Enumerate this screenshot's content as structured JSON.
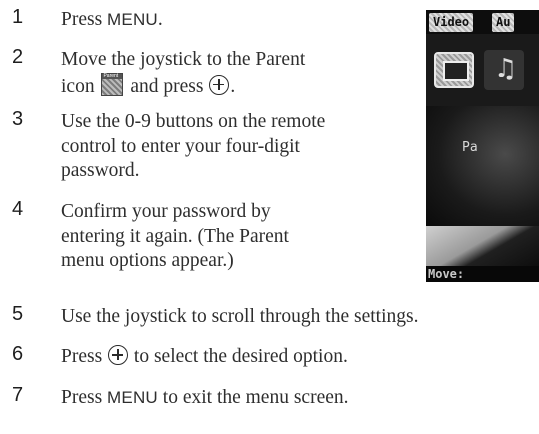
{
  "steps": [
    {
      "num": "1",
      "lines": [
        [
          "Press ",
          "MENU",
          "."
        ]
      ]
    },
    {
      "num": "2",
      "lines": [
        "Move the joystick to the Parent",
        [
          "icon ",
          "parent-icon",
          " and press ",
          "enter-icon",
          "."
        ]
      ]
    },
    {
      "num": "3",
      "lines": [
        "Use the 0-9 buttons on the remote",
        "control to enter your four-digit",
        "password."
      ]
    },
    {
      "num": "4",
      "lines": [
        "Confirm your password by",
        "entering it again. (The Parent",
        "menu options appear.)"
      ]
    },
    {
      "num": "5",
      "lines": [
        "Use the joystick to scroll through the settings."
      ]
    },
    {
      "num": "6",
      "lines": [
        [
          "Press ",
          "enter-icon",
          " to select the desired option."
        ]
      ]
    },
    {
      "num": "7",
      "lines": [
        [
          "Press ",
          "MENU",
          " to exit the menu screen."
        ]
      ]
    }
  ],
  "step1": {
    "num": "1",
    "pre": "Press ",
    "key": "MENU",
    "post": "."
  },
  "step2": {
    "num": "2",
    "line1": "Move the joystick to the Parent",
    "pre": "icon ",
    "icon_label": "Parent",
    "mid": " and press ",
    "post": "."
  },
  "step3": {
    "num": "3",
    "line1": "Use the 0-9 buttons on the remote",
    "line2": "control to enter your four-digit",
    "line3": "password."
  },
  "step4": {
    "num": "4",
    "line1": "Confirm your password by",
    "line2": "entering it again. (The Parent",
    "line3": "menu options appear.)"
  },
  "step5": {
    "num": "5",
    "text": "Use the joystick to scroll through the settings."
  },
  "step6": {
    "num": "6",
    "pre": "Press ",
    "post": " to select the desired option."
  },
  "step7": {
    "num": "7",
    "pre": "Press ",
    "key": "MENU",
    "post": " to exit the menu screen."
  },
  "screen": {
    "tab1": "Video",
    "tab2": "Au",
    "center_text": "Pa",
    "footer": "Move:"
  },
  "icons": [
    "parent-icon",
    "enter-icon",
    "note-icon",
    "screen-icon"
  ]
}
